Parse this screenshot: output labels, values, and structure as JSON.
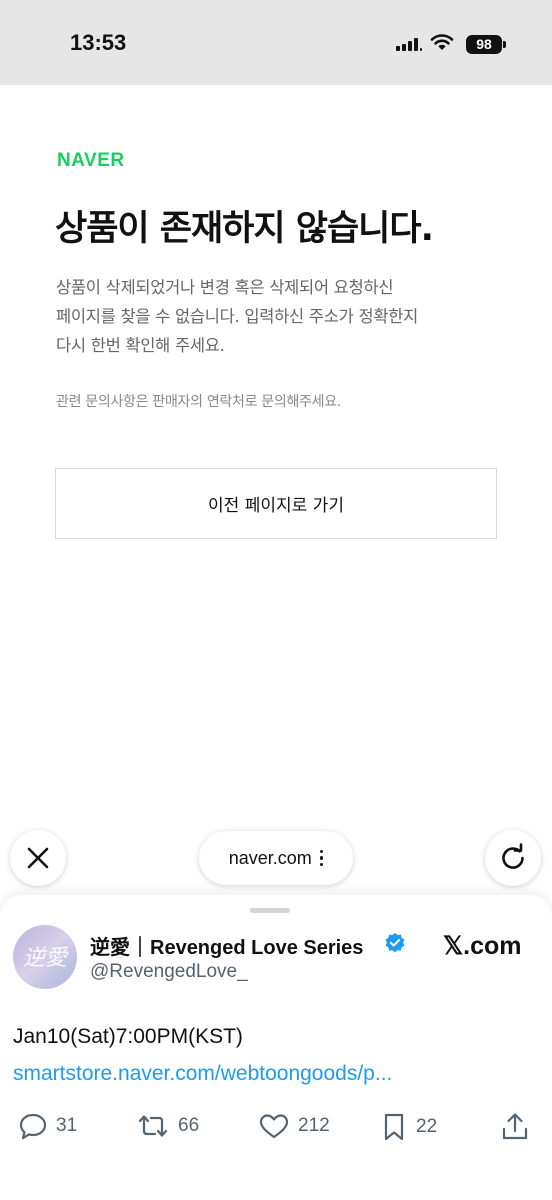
{
  "status_bar": {
    "time": "13:53",
    "battery": "98"
  },
  "page": {
    "logo": "NAVER",
    "title": "상품이 존재하지 않습니다.",
    "description_lines": [
      "상품이 삭제되었거나 변경 혹은 삭제되어 요청하신",
      "페이지를 찾을 수 없습니다. 입력하신 주소가 정확한지",
      "다시 한번 확인해 주세요."
    ],
    "note": "관련 문의사항은 판매자의 연락처로 문의해주세요.",
    "back_button": "이전 페이지로 가기"
  },
  "browser": {
    "url": "naver.com",
    "close_icon": "close-icon",
    "reload_icon": "reload-icon"
  },
  "tweet": {
    "author": "逆愛｜Revenged Love Series",
    "handle": "@RevengedLove_",
    "source": "𝕏.com",
    "avatar_text": "逆愛",
    "text": "Jan10(Sat)7:00PM(KST)",
    "link": "smartstore.naver.com/webtoongoods/p...",
    "stats": {
      "replies": "31",
      "retweets": "66",
      "likes": "212",
      "bookmarks": "22"
    }
  },
  "colors": {
    "naver_green": "#19ce60",
    "link_blue": "#1d9bf0",
    "verified_blue": "#1d9bf0",
    "status_bar_bg": "#e6e6e7"
  }
}
